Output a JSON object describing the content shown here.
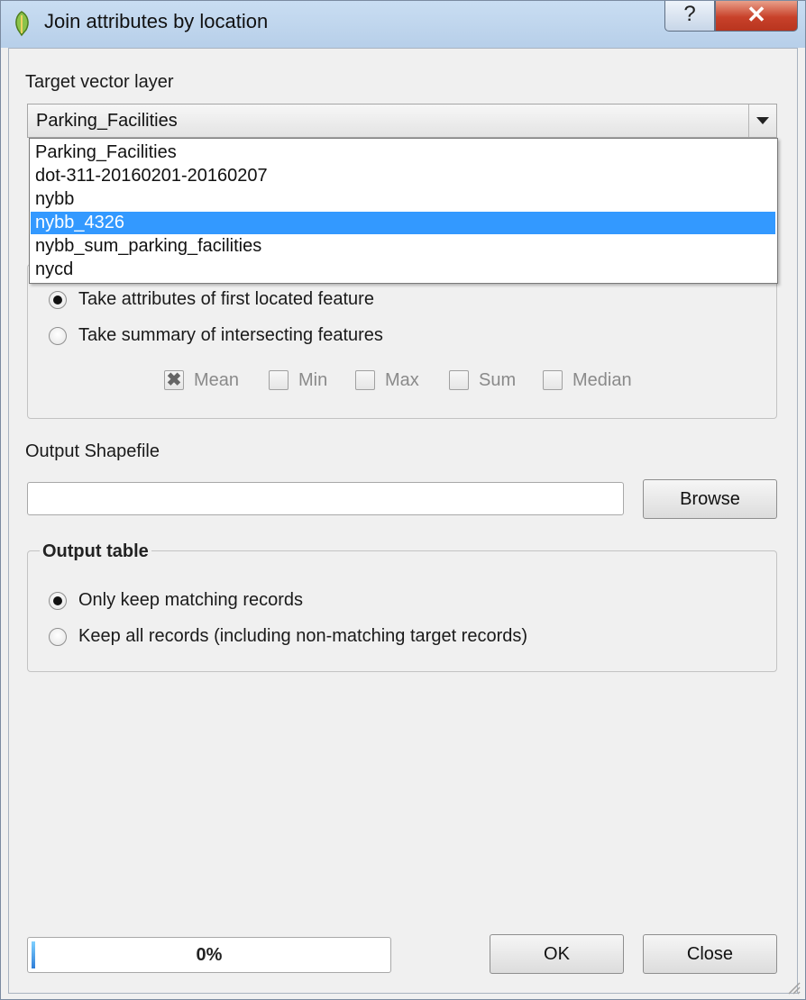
{
  "window": {
    "title": "Join attributes by location",
    "help_symbol": "?",
    "close_symbol": "✕"
  },
  "target": {
    "label": "Target vector layer",
    "selected": "Parking_Facilities",
    "options": [
      {
        "label": "Parking_Facilities",
        "highlighted": false
      },
      {
        "label": "dot-311-20160201-20160207",
        "highlighted": false
      },
      {
        "label": "nybb",
        "highlighted": false
      },
      {
        "label": "nybb_4326",
        "highlighted": true
      },
      {
        "label": "nybb_sum_parking_facilities",
        "highlighted": false
      },
      {
        "label": "nycd",
        "highlighted": false
      }
    ]
  },
  "attribute_summary": {
    "first_feature_label": "Take attributes of first located feature",
    "first_feature_checked": true,
    "summary_label": "Take summary of intersecting features",
    "summary_checked": false,
    "stats": [
      {
        "label": "Mean",
        "checked": true
      },
      {
        "label": "Min",
        "checked": false
      },
      {
        "label": "Max",
        "checked": false
      },
      {
        "label": "Sum",
        "checked": false
      },
      {
        "label": "Median",
        "checked": false
      }
    ]
  },
  "output": {
    "label": "Output Shapefile",
    "value": "",
    "browse_label": "Browse"
  },
  "output_table": {
    "title": "Output table",
    "keep_matching_label": "Only keep matching records",
    "keep_matching_checked": true,
    "keep_all_label": "Keep all records (including non-matching target records)",
    "keep_all_checked": false
  },
  "footer": {
    "progress_text": "0%",
    "progress_value": 0,
    "ok_label": "OK",
    "close_label": "Close"
  },
  "colors": {
    "selection": "#3399ff",
    "title_bar": "#c9ddf2",
    "close_button": "#c8412a"
  }
}
